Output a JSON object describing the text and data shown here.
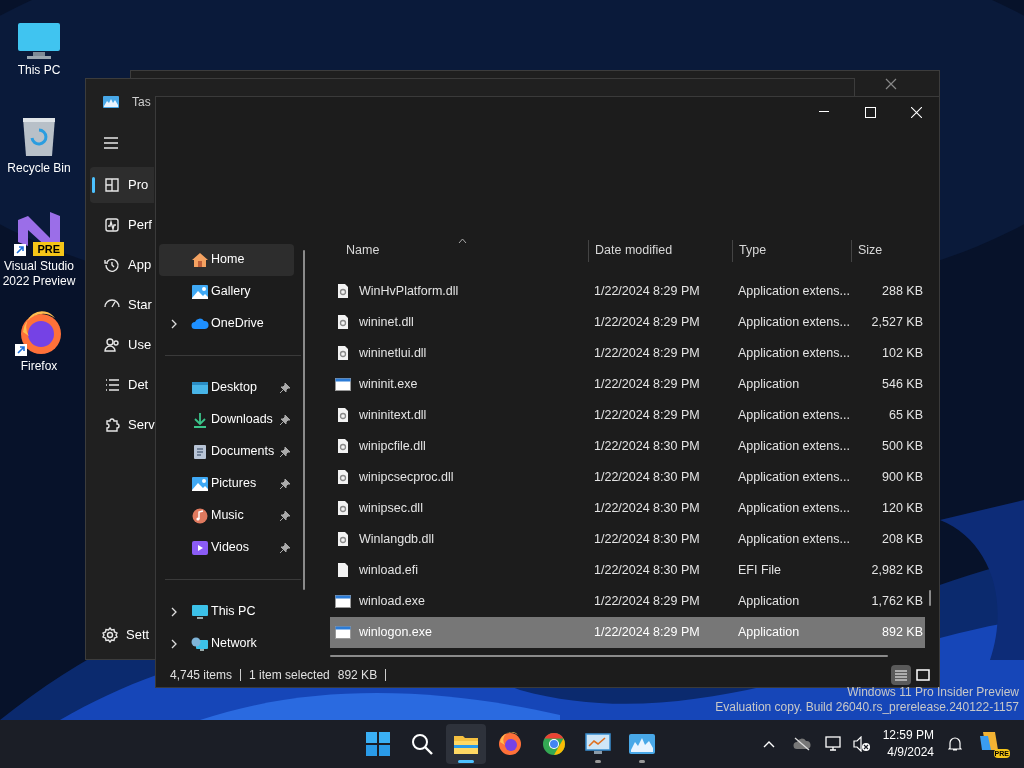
{
  "desktop_icons": [
    {
      "label": "This PC",
      "kind": "pc"
    },
    {
      "label": "Recycle Bin",
      "kind": "bin"
    },
    {
      "label": "Visual Studio 2022 Preview",
      "kind": "vs",
      "badge": "PRE"
    },
    {
      "label": "Firefox",
      "kind": "firefox"
    }
  ],
  "task_manager": {
    "title": "Tas",
    "nav": [
      {
        "label": "Pro",
        "kind": "processes",
        "selected": true
      },
      {
        "label": "Perf",
        "kind": "performance",
        "selected": false
      },
      {
        "label": "App",
        "kind": "history",
        "selected": false
      },
      {
        "label": "Star",
        "kind": "startup",
        "selected": false
      },
      {
        "label": "Use",
        "kind": "users",
        "selected": false
      },
      {
        "label": "Det",
        "kind": "details",
        "selected": false
      },
      {
        "label": "Serv",
        "kind": "services",
        "selected": false
      }
    ],
    "settings": "Sett"
  },
  "explorer": {
    "nav_groups": [
      [
        {
          "label": "Home",
          "kind": "home",
          "selected": true,
          "expandable": false,
          "pinned": false
        },
        {
          "label": "Gallery",
          "kind": "gallery",
          "selected": false,
          "expandable": false,
          "pinned": false
        },
        {
          "label": "OneDrive",
          "kind": "cloud",
          "selected": false,
          "expandable": true,
          "pinned": false
        }
      ],
      [
        {
          "label": "Desktop",
          "kind": "desktop",
          "selected": false,
          "expandable": false,
          "pinned": true
        },
        {
          "label": "Downloads",
          "kind": "downloads",
          "selected": false,
          "expandable": false,
          "pinned": true
        },
        {
          "label": "Documents",
          "kind": "documents",
          "selected": false,
          "expandable": false,
          "pinned": true
        },
        {
          "label": "Pictures",
          "kind": "gallery",
          "selected": false,
          "expandable": false,
          "pinned": true
        },
        {
          "label": "Music",
          "kind": "music",
          "selected": false,
          "expandable": false,
          "pinned": true
        },
        {
          "label": "Videos",
          "kind": "videos",
          "selected": false,
          "expandable": false,
          "pinned": true
        }
      ],
      [
        {
          "label": "This PC",
          "kind": "pc",
          "selected": false,
          "expandable": true,
          "pinned": false
        },
        {
          "label": "Network",
          "kind": "network",
          "selected": false,
          "expandable": true,
          "pinned": false
        }
      ]
    ],
    "columns": [
      "Name",
      "Date modified",
      "Type",
      "Size"
    ],
    "rows": [
      {
        "name": "WinHvPlatform.dll",
        "date": "1/22/2024 8:29 PM",
        "type": "Application extens...",
        "size": "288 KB",
        "kind": "dll",
        "selected": false
      },
      {
        "name": "wininet.dll",
        "date": "1/22/2024 8:29 PM",
        "type": "Application extens...",
        "size": "2,527 KB",
        "kind": "dll",
        "selected": false
      },
      {
        "name": "wininetlui.dll",
        "date": "1/22/2024 8:29 PM",
        "type": "Application extens...",
        "size": "102 KB",
        "kind": "dll",
        "selected": false
      },
      {
        "name": "wininit.exe",
        "date": "1/22/2024 8:29 PM",
        "type": "Application",
        "size": "546 KB",
        "kind": "exe",
        "selected": false
      },
      {
        "name": "wininitext.dll",
        "date": "1/22/2024 8:29 PM",
        "type": "Application extens...",
        "size": "65 KB",
        "kind": "dll",
        "selected": false
      },
      {
        "name": "winipcfile.dll",
        "date": "1/22/2024 8:30 PM",
        "type": "Application extens...",
        "size": "500 KB",
        "kind": "dll",
        "selected": false
      },
      {
        "name": "winipcsecproc.dll",
        "date": "1/22/2024 8:30 PM",
        "type": "Application extens...",
        "size": "900 KB",
        "kind": "dll",
        "selected": false
      },
      {
        "name": "winipsec.dll",
        "date": "1/22/2024 8:30 PM",
        "type": "Application extens...",
        "size": "120 KB",
        "kind": "dll",
        "selected": false
      },
      {
        "name": "Winlangdb.dll",
        "date": "1/22/2024 8:30 PM",
        "type": "Application extens...",
        "size": "208 KB",
        "kind": "dll",
        "selected": false
      },
      {
        "name": "winload.efi",
        "date": "1/22/2024 8:30 PM",
        "type": "EFI File",
        "size": "2,982 KB",
        "kind": "file",
        "selected": false
      },
      {
        "name": "winload.exe",
        "date": "1/22/2024 8:29 PM",
        "type": "Application",
        "size": "1,762 KB",
        "kind": "exe",
        "selected": false
      },
      {
        "name": "winlogon.exe",
        "date": "1/22/2024 8:29 PM",
        "type": "Application",
        "size": "892 KB",
        "kind": "exe",
        "selected": true
      }
    ],
    "status": {
      "items": "4,745 items",
      "selection": "1 item selected",
      "size": "892 KB"
    },
    "views": [
      {
        "kind": "details",
        "selected": true
      },
      {
        "kind": "tiles",
        "selected": false
      }
    ]
  },
  "watermark": [
    "Windows 11 Pro Insider Preview",
    "Evaluation copy. Build 26040.rs_prerelease.240122-1157"
  ],
  "taskbar": {
    "apps": [
      {
        "kind": "start",
        "active": false,
        "running": false
      },
      {
        "kind": "search",
        "active": false,
        "running": false
      },
      {
        "kind": "explorer",
        "active": true,
        "running": true
      },
      {
        "kind": "firefox",
        "active": false,
        "running": false
      },
      {
        "kind": "chrome",
        "active": false,
        "running": false
      },
      {
        "kind": "remote",
        "active": false,
        "running": true
      },
      {
        "kind": "taskmgr",
        "active": false,
        "running": true
      }
    ],
    "time": "12:59 PM",
    "date": "4/9/2024",
    "copilot_badge": "PRE"
  }
}
